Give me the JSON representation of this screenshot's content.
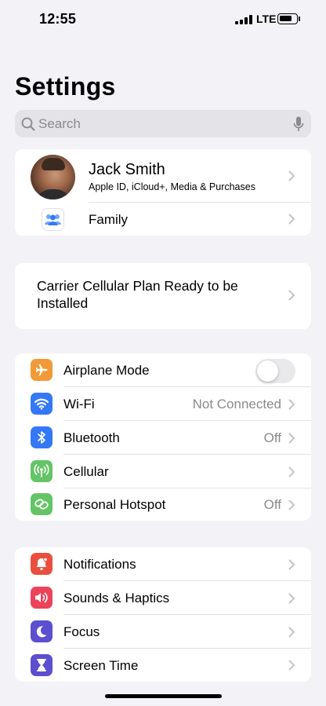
{
  "status_bar": {
    "time": "12:55",
    "network": "LTE"
  },
  "title": "Settings",
  "search": {
    "placeholder": "Search"
  },
  "profile": {
    "name": "Jack Smith",
    "subtitle": "Apple ID, iCloud+, Media & Purchases",
    "family_label": "Family"
  },
  "carrier_banner": {
    "text": "Carrier Cellular Plan Ready to be Installed"
  },
  "connectivity": [
    {
      "label": "Airplane Mode",
      "icon": "airplane-icon",
      "color": "#f19a37",
      "toggle": false
    },
    {
      "label": "Wi-Fi",
      "icon": "wifi-icon",
      "color": "#3478f6",
      "value": "Not Connected"
    },
    {
      "label": "Bluetooth",
      "icon": "bluetooth-icon",
      "color": "#3478f6",
      "value": "Off"
    },
    {
      "label": "Cellular",
      "icon": "cellular-antenna-icon",
      "color": "#65c466",
      "value": ""
    },
    {
      "label": "Personal Hotspot",
      "icon": "hotspot-link-icon",
      "color": "#65c466",
      "value": "Off"
    }
  ],
  "general": [
    {
      "label": "Notifications",
      "icon": "bell-icon",
      "color": "#eb4e3d"
    },
    {
      "label": "Sounds & Haptics",
      "icon": "speaker-icon",
      "color": "#eb445a"
    },
    {
      "label": "Focus",
      "icon": "moon-icon",
      "color": "#5b4fcf"
    },
    {
      "label": "Screen Time",
      "icon": "hourglass-icon",
      "color": "#5b4fcf"
    }
  ]
}
